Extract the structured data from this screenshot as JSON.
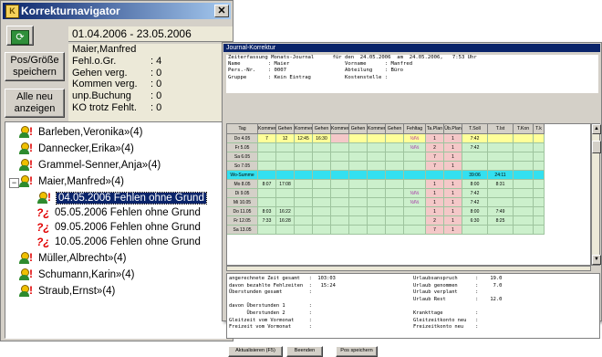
{
  "nav": {
    "title": "Korrekturnavigator",
    "close_glyph": "✕",
    "refresh_icon": "refresh-icon",
    "date_range": "01.04.2006 - 23.05.2006",
    "pos_button": {
      "line1": "Pos/Größe",
      "line2": "speichern"
    },
    "neu_button": {
      "line1": "Alle neu",
      "line2": "anzeigen"
    },
    "info": {
      "name": "Maier,Manfred",
      "rows": [
        {
          "label": "Fehl.o.Gr.",
          "value": ": 4"
        },
        {
          "label": "Gehen verg.",
          "value": ": 0"
        },
        {
          "label": "Kommen verg.",
          "value": ": 0"
        },
        {
          "label": "unp.Buchung",
          "value": ": 0"
        },
        {
          "label": "KO trotz Fehlt.",
          "value": ": 0"
        }
      ]
    },
    "tree": {
      "persons_before": [
        "Barleben,Veronika»(4)",
        "Dannecker,Erika»(4)",
        "Grammel-Senner,Anja»(4)"
      ],
      "expanded": "Maier,Manfred»(4)",
      "children": [
        "04.05.2006 Fehlen ohne Grund",
        "05.05.2006 Fehlen ohne Grund",
        "09.05.2006 Fehlen ohne Grund",
        "10.05.2006 Fehlen ohne Grund"
      ],
      "persons_after": [
        "Müller,Albrecht»(4)",
        "Schumann,Karin»(4)",
        "Straub,Ernst»(4)"
      ]
    }
  },
  "journal": {
    "title": "Journal-Korrektur",
    "header_lines": [
      "Zeiterfassung Monats-Journal      für den  24.05.2006  am  24.05.2006,   7:53 Uhr",
      "Name         : Maier                  Vorname      : Manfred",
      "Pers.-Nr.    : 0007                   Abteilung    : Büro",
      "Gruppe       : Kein Eintrag           Kostenstelle :"
    ],
    "columns": [
      "Tag",
      "Kommen",
      "Gehen",
      "Kommen",
      "Gehen",
      "Kommen",
      "Gehen",
      "Kommen",
      "Gehen",
      "Fehltag",
      "Ta.Plan",
      "Üb.Plan",
      "T.Soll",
      "T.Ist",
      "T.Kon",
      "T.k"
    ],
    "rows": [
      {
        "cells": [
          "Do 4.05",
          "7",
          "12",
          "12:45",
          "16:30",
          "",
          "",
          "",
          "",
          "½/½",
          "1",
          "1",
          "7:42",
          "",
          "",
          ""
        ],
        "style": "yellow"
      },
      {
        "cells": [
          "Fr 5.05",
          "",
          "",
          "",
          "",
          "",
          "",
          "",
          "",
          "½/½",
          "2",
          "1",
          "7:42",
          "",
          "",
          ""
        ],
        "style": "green"
      },
      {
        "cells": [
          "Sa 6.05",
          "",
          "",
          "",
          "",
          "",
          "",
          "",
          "",
          "",
          "7",
          "1",
          "",
          "",
          "",
          ""
        ],
        "style": "green"
      },
      {
        "cells": [
          "So 7.05",
          "",
          "",
          "",
          "",
          "",
          "",
          "",
          "",
          "",
          "7",
          "1",
          "",
          "",
          "",
          ""
        ],
        "style": "green"
      },
      {
        "cells": [
          "Wo-Summe",
          "",
          "",
          "",
          "",
          "",
          "",
          "",
          "",
          "",
          "",
          "",
          "39:06",
          "24:11",
          "",
          ""
        ],
        "style": "cyan"
      },
      {
        "cells": [
          "Mo 8.05",
          "8:07",
          "17:08",
          "",
          "",
          "",
          "",
          "",
          "",
          "",
          "1",
          "1",
          "8:00",
          "8:31",
          "",
          ""
        ],
        "style": "green"
      },
      {
        "cells": [
          "Di 9.05",
          "",
          "",
          "",
          "",
          "",
          "",
          "",
          "",
          "½/½",
          "1",
          "1",
          "7:42",
          "",
          "",
          ""
        ],
        "style": "green"
      },
      {
        "cells": [
          "Mi 10.05",
          "",
          "",
          "",
          "",
          "",
          "",
          "",
          "",
          "½/½",
          "1",
          "1",
          "7:42",
          "",
          "",
          ""
        ],
        "style": "green"
      },
      {
        "cells": [
          "Do 11.05",
          "8:03",
          "16:22",
          "",
          "",
          "",
          "",
          "",
          "",
          "",
          "1",
          "1",
          "8:00",
          "7:49",
          "",
          ""
        ],
        "style": "green"
      },
      {
        "cells": [
          "Fr 12.05",
          "7:33",
          "16:28",
          "",
          "",
          "",
          "",
          "",
          "",
          "",
          "2",
          "1",
          "6:30",
          "8:25",
          "",
          ""
        ],
        "style": "green"
      },
      {
        "cells": [
          "Sa 13.05",
          "",
          "",
          "",
          "",
          "",
          "",
          "",
          "",
          "",
          "7",
          "1",
          "",
          "",
          "",
          ""
        ],
        "style": "green"
      }
    ],
    "summary_left": [
      "angerechnete Zeit gesamt   :  103:03",
      "davon bezahlte Fehlzeiten  :   15:24",
      "Überstunden gesamt         :",
      "",
      "davon Überstunden 1        :",
      "      Überstunden 2        :",
      "Gleitzeit vom Vormonat     :",
      "Freizeit vom Vormonat      :"
    ],
    "summary_right": [
      "Urlaubsanspruch      :    19.0",
      "Urlaub genommen      :     7.0",
      "Urlaub verplant      :",
      "Urlaub Rest          :    12.0",
      "",
      "Krankttage           :",
      "Gleitzeitkonto neu   :",
      "Freizeitkonto neu    :"
    ],
    "buttons": {
      "refresh": "Aktualisieren (F5)",
      "close": "Beenden",
      "save_pos": "Pos speichern"
    }
  },
  "colors": {
    "yellow": "#ffff99",
    "green": "#ccf0cc",
    "cyan": "#33e0f0",
    "rose": "#f4c8c8",
    "sel": "#0a246a"
  }
}
